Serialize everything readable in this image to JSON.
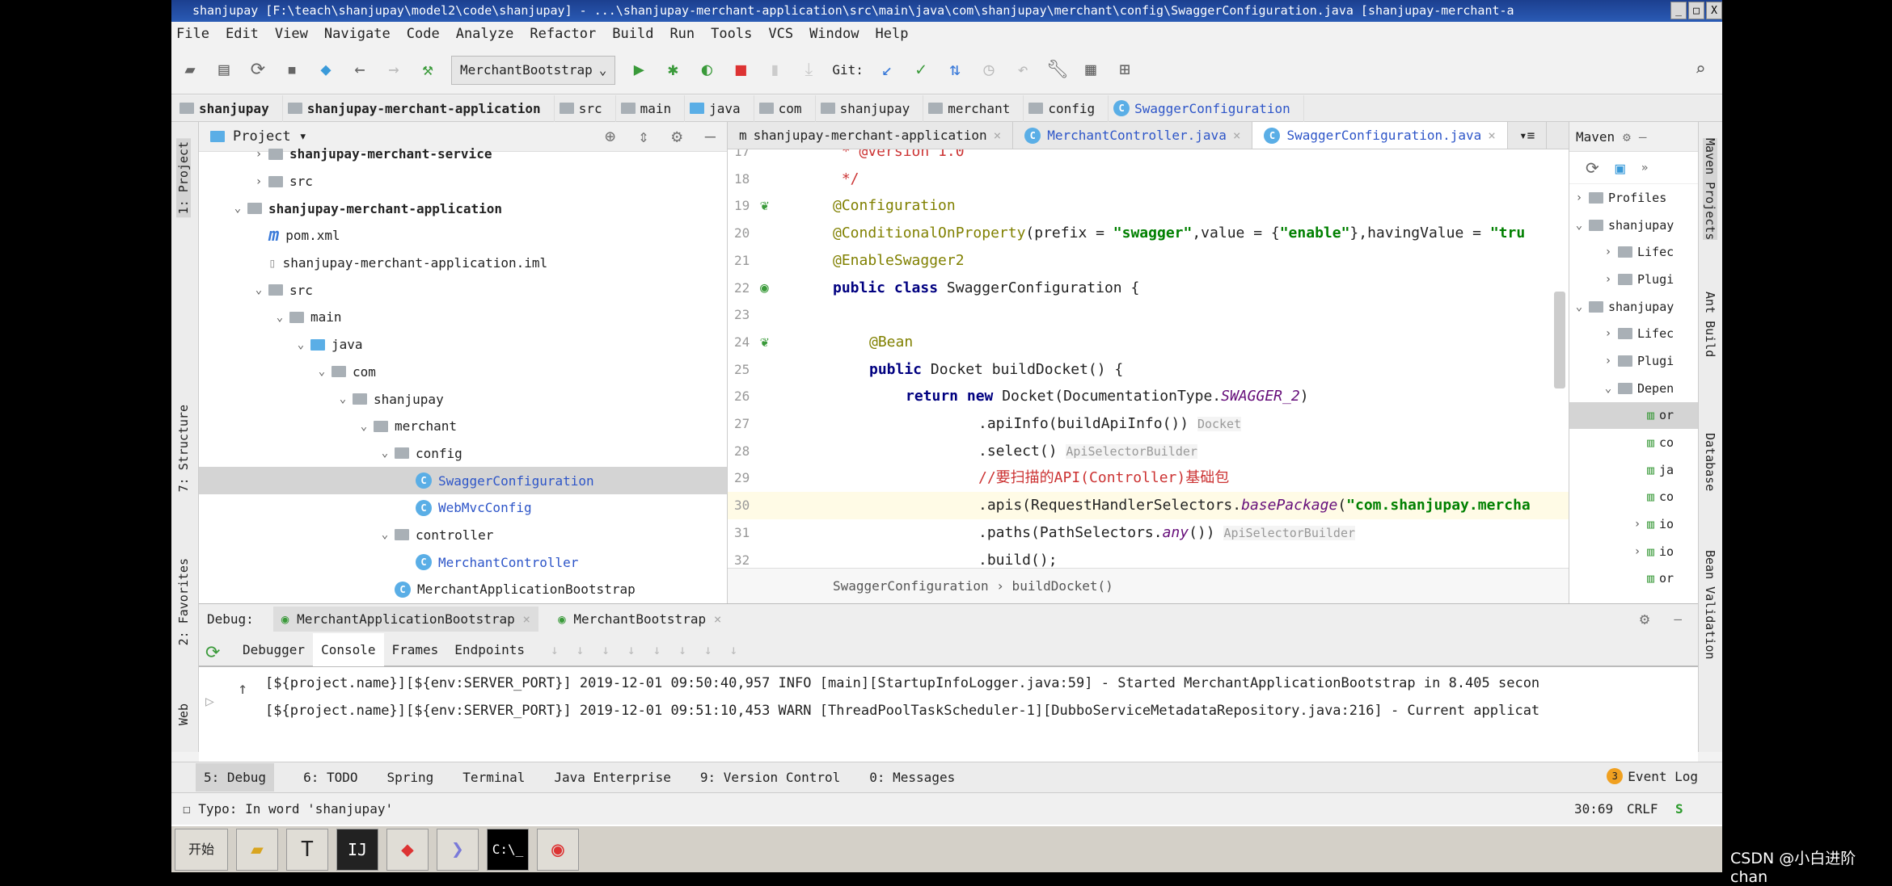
{
  "window": {
    "title": "shanjupay [F:\\teach\\shanjupay\\model2\\code\\shanjupay] - ...\\shanjupay-merchant-application\\src\\main\\java\\com\\shanjupay\\merchant\\config\\SwaggerConfiguration.java [shanjupay-merchant-a"
  },
  "menu": [
    "File",
    "Edit",
    "View",
    "Navigate",
    "Code",
    "Analyze",
    "Refactor",
    "Build",
    "Run",
    "Tools",
    "VCS",
    "Window",
    "Help"
  ],
  "toolbar": {
    "run_config": "MerchantBootstrap",
    "git_label": "Git:"
  },
  "breadcrumb": [
    "shanjupay",
    "shanjupay-merchant-application",
    "src",
    "main",
    "java",
    "com",
    "shanjupay",
    "merchant",
    "config",
    "SwaggerConfiguration"
  ],
  "left_stripe": {
    "project": "1: Project",
    "structure": "7: Structure",
    "favorites": "2: Favorites",
    "web": "Web"
  },
  "project": {
    "title": "Project",
    "tree": [
      {
        "label": "shanjupay-merchant-service",
        "depth": 2,
        "arrow": "›",
        "icon": "module",
        "bold": true
      },
      {
        "label": "src",
        "depth": 2,
        "arrow": "›",
        "icon": "folder"
      },
      {
        "label": "shanjupay-merchant-application",
        "depth": 1,
        "arrow": "⌄",
        "icon": "module",
        "bold": true
      },
      {
        "label": "pom.xml",
        "depth": 2,
        "icon": "maven"
      },
      {
        "label": "shanjupay-merchant-application.iml",
        "depth": 2,
        "icon": "file"
      },
      {
        "label": "src",
        "depth": 2,
        "arrow": "⌄",
        "icon": "folder"
      },
      {
        "label": "main",
        "depth": 3,
        "arrow": "⌄",
        "icon": "folder"
      },
      {
        "label": "java",
        "depth": 4,
        "arrow": "⌄",
        "icon": "folder-blue"
      },
      {
        "label": "com",
        "depth": 5,
        "arrow": "⌄",
        "icon": "package"
      },
      {
        "label": "shanjupay",
        "depth": 6,
        "arrow": "⌄",
        "icon": "package"
      },
      {
        "label": "merchant",
        "depth": 7,
        "arrow": "⌄",
        "icon": "package"
      },
      {
        "label": "config",
        "depth": 8,
        "arrow": "⌄",
        "icon": "package"
      },
      {
        "label": "SwaggerConfiguration",
        "depth": 9,
        "icon": "class",
        "cls": true,
        "selected": true
      },
      {
        "label": "WebMvcConfig",
        "depth": 9,
        "icon": "class",
        "cls": true
      },
      {
        "label": "controller",
        "depth": 8,
        "arrow": "⌄",
        "icon": "package"
      },
      {
        "label": "MerchantController",
        "depth": 9,
        "icon": "class",
        "cls": true
      },
      {
        "label": "MerchantApplicationBootstrap",
        "depth": 8,
        "icon": "spring-class"
      }
    ]
  },
  "editor": {
    "tabs": [
      {
        "label": "shanjupay-merchant-application",
        "icon": "maven"
      },
      {
        "label": "MerchantController.java",
        "icon": "class"
      },
      {
        "label": "SwaggerConfiguration.java",
        "icon": "class",
        "active": true
      }
    ],
    "lines": [
      {
        "n": "17",
        "indent": 0,
        "seg": [
          [
            "com",
            " * @version 1.0"
          ]
        ]
      },
      {
        "n": "18",
        "indent": 0,
        "seg": [
          [
            "com",
            " */"
          ]
        ]
      },
      {
        "n": "19",
        "indent": 0,
        "gutter": "bean-icon",
        "seg": [
          [
            "ann",
            "@Configuration"
          ]
        ]
      },
      {
        "n": "20",
        "indent": 0,
        "seg": [
          [
            "ann",
            "@ConditionalOnProperty"
          ],
          [
            "",
            "(prefix = "
          ],
          [
            "str",
            "\"swagger\""
          ],
          [
            "",
            ",value = {"
          ],
          [
            "str",
            "\"enable\""
          ],
          [
            "",
            "},havingValue = "
          ],
          [
            "str",
            "\"tru"
          ]
        ]
      },
      {
        "n": "21",
        "indent": 0,
        "seg": [
          [
            "ann",
            "@EnableSwagger2"
          ]
        ]
      },
      {
        "n": "22",
        "indent": 0,
        "gutter": "class-icon",
        "seg": [
          [
            "kw",
            "public class "
          ],
          [
            "",
            "SwaggerConfiguration {"
          ]
        ]
      },
      {
        "n": "23",
        "indent": 0,
        "seg": []
      },
      {
        "n": "24",
        "indent": 1,
        "gutter": "bean-icon",
        "seg": [
          [
            "ann",
            "@Bean"
          ]
        ]
      },
      {
        "n": "25",
        "indent": 1,
        "seg": [
          [
            "kw",
            "public "
          ],
          [
            "",
            "Docket buildDocket() {"
          ]
        ]
      },
      {
        "n": "26",
        "indent": 2,
        "seg": [
          [
            "kw",
            "return new "
          ],
          [
            "",
            "Docket(DocumentationType."
          ],
          [
            "it",
            "SWAGGER_2"
          ],
          [
            "",
            ")"
          ]
        ]
      },
      {
        "n": "27",
        "indent": 4,
        "seg": [
          [
            "",
            ".apiInfo(buildApiInfo()) "
          ],
          [
            "hint",
            "Docket"
          ]
        ]
      },
      {
        "n": "28",
        "indent": 4,
        "seg": [
          [
            "",
            ".select() "
          ],
          [
            "hint",
            "ApiSelectorBuilder"
          ]
        ]
      },
      {
        "n": "29",
        "indent": 4,
        "seg": [
          [
            "com",
            "//要扫描的API(Controller)基础包"
          ]
        ]
      },
      {
        "n": "30",
        "indent": 4,
        "hl": true,
        "seg": [
          [
            "",
            ".apis(RequestHandlerSelectors."
          ],
          [
            "it",
            "basePackage"
          ],
          [
            "",
            "("
          ],
          [
            "str",
            "\"com.shanjupay.mercha"
          ]
        ]
      },
      {
        "n": "31",
        "indent": 4,
        "seg": [
          [
            "",
            ".paths(PathSelectors."
          ],
          [
            "it",
            "any"
          ],
          [
            "",
            "()) "
          ],
          [
            "hint",
            "ApiSelectorBuilder"
          ]
        ]
      },
      {
        "n": "32",
        "indent": 4,
        "seg": [
          [
            "",
            ".build();"
          ]
        ]
      },
      {
        "n": "33",
        "indent": 1,
        "seg": [
          [
            "",
            "}"
          ]
        ]
      }
    ],
    "breadcrumb": "SwaggerConfiguration  ›  buildDocket()"
  },
  "maven": {
    "title": "Maven",
    "items": [
      {
        "label": "Profiles",
        "depth": 0,
        "arrow": "›"
      },
      {
        "label": "shanjupay",
        "depth": 0,
        "arrow": "⌄"
      },
      {
        "label": "Lifec",
        "depth": 1,
        "arrow": "›"
      },
      {
        "label": "Plugi",
        "depth": 1,
        "arrow": "›"
      },
      {
        "label": "shanjupay",
        "depth": 0,
        "arrow": "⌄"
      },
      {
        "label": "Lifec",
        "depth": 1,
        "arrow": "›"
      },
      {
        "label": "Plugi",
        "depth": 1,
        "arrow": "›"
      },
      {
        "label": "Depen",
        "depth": 1,
        "arrow": "⌄"
      },
      {
        "label": "or",
        "depth": 2,
        "selected": true
      },
      {
        "label": "co",
        "depth": 2
      },
      {
        "label": "ja",
        "depth": 2
      },
      {
        "label": "co",
        "depth": 2
      },
      {
        "label": "io",
        "depth": 2,
        "arrow": "›"
      },
      {
        "label": "io",
        "depth": 2,
        "arrow": "›"
      },
      {
        "label": "or",
        "depth": 2
      }
    ]
  },
  "right_stripe": {
    "maven": "Maven Projects",
    "ant": "Ant Build",
    "database": "Database",
    "bean": "Bean Validation"
  },
  "debug": {
    "label": "Debug:",
    "sessions": [
      "MerchantApplicationBootstrap",
      "MerchantBootstrap"
    ],
    "tabs": [
      "Debugger",
      "Console",
      "Frames",
      "Endpoints"
    ],
    "console": [
      "[${project.name}][${env:SERVER_PORT}] 2019-12-01 09:50:40,957 INFO [main][StartupInfoLogger.java:59] - Started MerchantApplicationBootstrap in 8.405 secon",
      "[${project.name}][${env:SERVER_PORT}] 2019-12-01 09:51:10,453 WARN [ThreadPoolTaskScheduler-1][DubboServiceMetadataRepository.java:216] - Current applicat"
    ]
  },
  "bottom_tabs": [
    "5: Debug",
    "6: TODO",
    "Spring",
    "Terminal",
    "Java Enterprise",
    "9: Version Control",
    "0: Messages"
  ],
  "event_log": {
    "label": "Event Log",
    "count": "3"
  },
  "status": {
    "message": "Typo: In word 'shanjupay'",
    "position": "30:69",
    "line_sep": "CRLF"
  },
  "taskbar": {
    "start": "开始"
  },
  "watermark": "CSDN @小白进阶chan"
}
